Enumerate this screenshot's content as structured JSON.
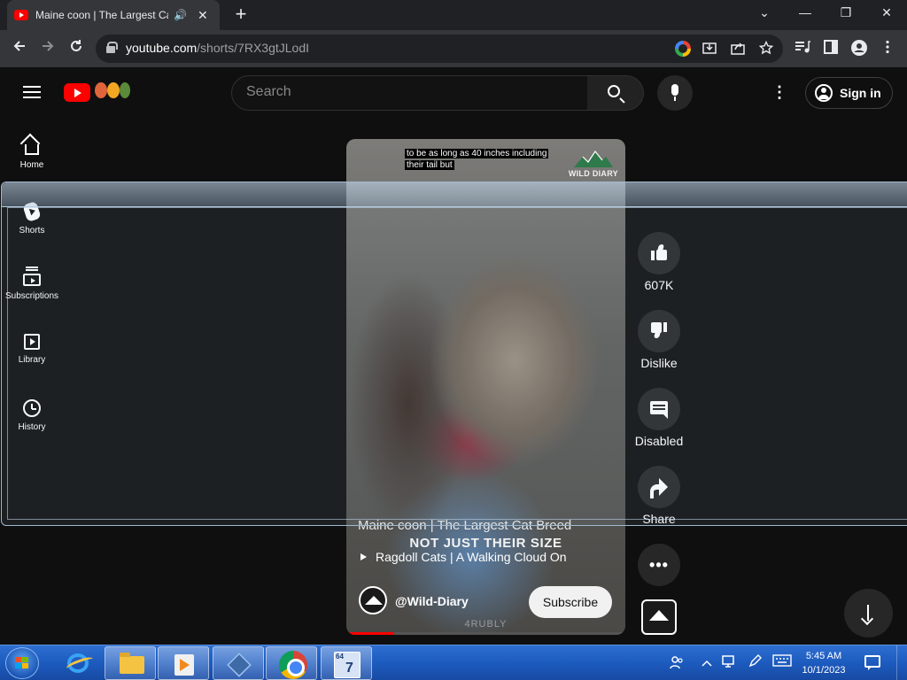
{
  "browser": {
    "tab_title": "Maine coon | The Largest Ca",
    "audio_icon": "🔊",
    "close_glyph": "✕",
    "newtab_glyph": "+",
    "url_host": "youtube.com",
    "url_path": "/shorts/7RX3gtJLodI",
    "controls": {
      "minimize": "—",
      "restore": "❐",
      "close": "✕",
      "menu": "⌄"
    },
    "icons": [
      "back-icon",
      "forward-icon",
      "reload-icon",
      "google-lens-icon",
      "install-icon",
      "share-icon",
      "bookmark-star-icon",
      "media-control-icon",
      "side-panel-icon",
      "profile-icon",
      "chrome-menu-icon"
    ]
  },
  "youtube": {
    "search_placeholder": "Search",
    "signin_label": "Sign in",
    "more_glyph": "⋮",
    "sidebar": [
      {
        "label": "Home",
        "icon": "home-icon"
      },
      {
        "label": "Shorts",
        "icon": "shorts-icon"
      },
      {
        "label": "Subscriptions",
        "icon": "subscriptions-icon"
      },
      {
        "label": "Library",
        "icon": "library-icon"
      },
      {
        "label": "History",
        "icon": "history-icon"
      }
    ]
  },
  "video": {
    "caption_line1": "to be as long as 40 inches including",
    "caption_line2": "their tail but",
    "watermark_brand": "WILD DIARY",
    "title": "Maine coon | The Largest Cat Breed",
    "overlay_text": "NOT JUST THEIR SIZE",
    "linked_video": "Ragdoll Cats | A Walking Cloud On",
    "channel": "@Wild-Diary",
    "subscribe_label": "Subscribe",
    "bottom_watermark": "4RUBLY",
    "progress_fraction": 0.17
  },
  "actions": {
    "like_count": "607K",
    "dislike_label": "Dislike",
    "comments_label": "Disabled",
    "share_label": "Share",
    "more_glyph": "•••"
  },
  "taskbar": {
    "apps": [
      "internet-explorer",
      "file-explorer",
      "media-player",
      "virtualbox",
      "chrome",
      "setup-64-7"
    ],
    "setup_bits": "64",
    "setup_version": "7",
    "time": "5:45 AM",
    "date": "10/1/2023"
  },
  "colors": {
    "yt_red": "#ff0000",
    "yt_bg": "#0f0f0f",
    "chrome_dark": "#35363a",
    "taskbar_blue": "#1d5bbf"
  }
}
